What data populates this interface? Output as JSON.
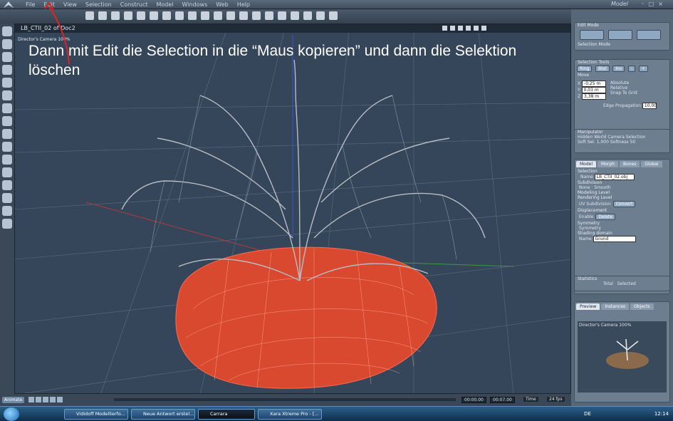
{
  "menubar": {
    "items": [
      "File",
      "Edit",
      "View",
      "Selection",
      "Construct",
      "Model",
      "Windows",
      "Web",
      "Help"
    ],
    "room_label": "Model"
  },
  "viewport": {
    "title": "LB_CTII_02 of Doc2",
    "camera_label": "Director's Camera 100%",
    "annotation": "Dann mit Edit die Selection in die “Maus kopieren” und dann die Selektion löschen"
  },
  "panel": {
    "edit_mode": "Edit Mode",
    "selection_mode": "Selection Mode",
    "selection_tools": "Selection Tools",
    "tool_buttons": [
      "Ring",
      "Blat",
      "Inv",
      "-",
      "+"
    ],
    "move": "Move",
    "x": "-0,25 m",
    "y": "0,03 m",
    "z": "3,38 m",
    "absolute": "Absolute",
    "relative": "Relative",
    "snap": "Snap To Grid",
    "edge_prop": "Edge Propagation",
    "edge_val": "10,00",
    "manipulator": "Manipulator",
    "hidden": "Hidden",
    "world": "World",
    "camera": "Camera",
    "selection": "Selection",
    "soft_sel": "Soft Sel.",
    "soft_val": "1,000",
    "softness": "Softness",
    "softness_val": "50",
    "tabs": [
      "Model",
      "Morph",
      "Bones",
      "Global"
    ],
    "section": "Selection",
    "name_label": "Name",
    "name_value": "LB_CTII_02.obj",
    "subdivision": "Subdivision",
    "none": "None",
    "smooth": "Smooth",
    "modeling_level": "Modeling Level",
    "rendering_level": "Rendering Level",
    "uv_sub": "UV Subdivision",
    "convert": "Convert",
    "displacement": "Displacement",
    "enable": "Enable",
    "delete": "Delete",
    "symmetry_hdr": "Symmetry",
    "symmetry": "Symmetry",
    "shading": "Shading domain",
    "shading_name": "Name",
    "shading_value": "Grund",
    "statistics": "Statistics",
    "total": "Total",
    "selected": "Selected",
    "preview_tabs": [
      "Preview",
      "Instances",
      "Objects"
    ],
    "preview_cam": "Director's Camera 100%"
  },
  "timeline": {
    "animate": "Animate",
    "t1": "00:00.00",
    "t2": "00:07.00",
    "time": "Time",
    "fps": "24 fps"
  },
  "taskbar": {
    "items": [
      "Vididoff Modellierfo...",
      "Neue Antwort erstel...",
      "Carrara",
      "Xara Xtreme Pro - [..."
    ],
    "lang": "DE",
    "clock": "12:14"
  }
}
